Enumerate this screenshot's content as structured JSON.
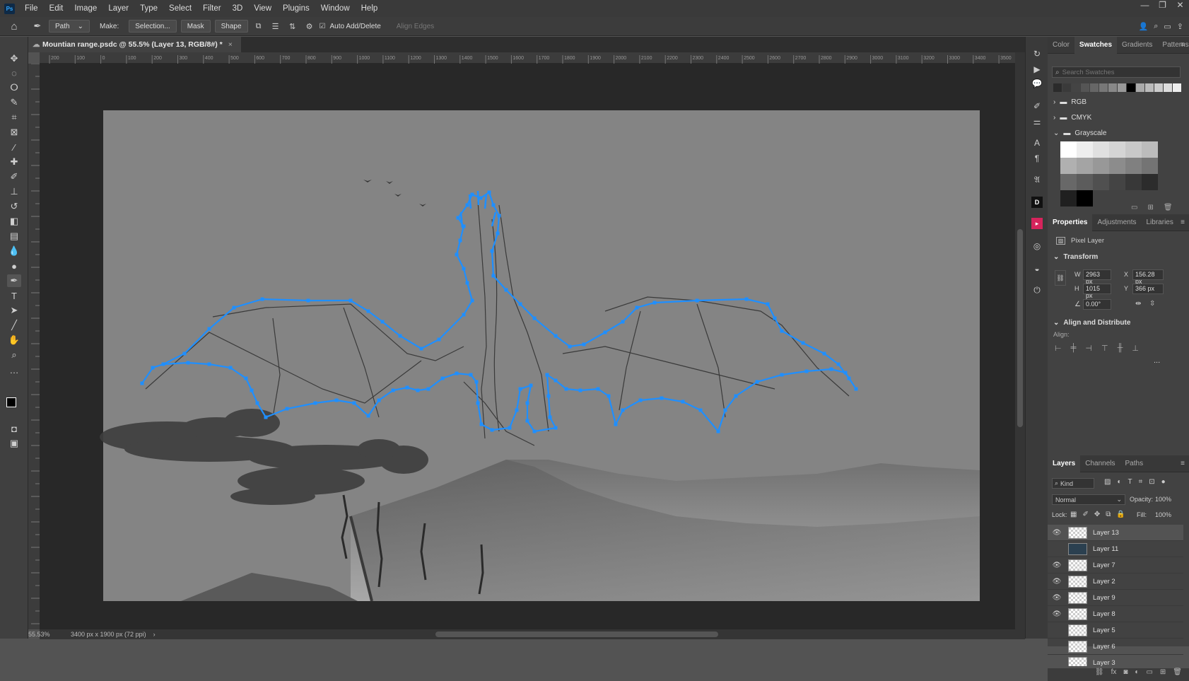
{
  "app": {
    "logo": "Ps"
  },
  "menu": [
    "File",
    "Edit",
    "Image",
    "Layer",
    "Type",
    "Select",
    "Filter",
    "3D",
    "View",
    "Plugins",
    "Window",
    "Help"
  ],
  "window_controls": [
    "—",
    "❐",
    "✕"
  ],
  "options_bar": {
    "tool_mode": "Path",
    "make_label": "Make:",
    "selection_btn": "Selection...",
    "mask_btn": "Mask",
    "shape_btn": "Shape",
    "auto_add_delete": "Auto Add/Delete",
    "align_edges": "Align Edges"
  },
  "document": {
    "tab_title": "Mountian range.psdc @ 55.5% (Layer 13, RGB/8#) *",
    "close": "×"
  },
  "ruler_labels": [
    "200",
    "100",
    "0",
    "100",
    "200",
    "300",
    "400",
    "500",
    "600",
    "700",
    "800",
    "900",
    "1000",
    "1100",
    "1200",
    "1300",
    "1400",
    "1500",
    "1600",
    "1700",
    "1800",
    "1900",
    "2000",
    "2100",
    "2200",
    "2300",
    "2400",
    "2500",
    "2600",
    "2700",
    "2800",
    "2900",
    "3000",
    "3100",
    "3200",
    "3300",
    "3400",
    "3500"
  ],
  "status": {
    "zoom": "55.53%",
    "doc_info": "3400 px x 1900 px (72 ppi)"
  },
  "swatches_panel": {
    "tabs": [
      "Color",
      "Swatches",
      "Gradients",
      "Patterns"
    ],
    "active_tab": "Swatches",
    "search_placeholder": "Search Swatches",
    "groups": [
      "RGB",
      "CMYK",
      "Grayscale"
    ],
    "recent_colors": [
      "#2b2b2b",
      "#3a3a3a",
      "#444444",
      "#555555",
      "#666666",
      "#777777",
      "#888888",
      "#999999",
      "#000000",
      "#aaaaaa",
      "#bbbbbb",
      "#cccccc",
      "#dddddd",
      "#eeeeee"
    ],
    "grayscale_colors": [
      "#ffffff",
      "#eeeeee",
      "#e0e0e0",
      "#d4d4d4",
      "#c8c8c8",
      "#bcbcbc",
      "#b0b0b0",
      "#a4a4a4",
      "#989898",
      "#8c8c8c",
      "#808080",
      "#747474",
      "#686868",
      "#5c5c5c",
      "#505050",
      "#444444",
      "#383838",
      "#2c2c2c",
      "#202020",
      "#000000"
    ]
  },
  "properties_panel": {
    "tabs": [
      "Properties",
      "Adjustments",
      "Libraries"
    ],
    "active_tab": "Properties",
    "layer_type": "Pixel Layer",
    "transform_label": "Transform",
    "w_label": "W",
    "w": "2963 px",
    "x_label": "X",
    "x": "156.28 px",
    "h_label": "H",
    "h": "1015 px",
    "y_label": "Y",
    "y": "366 px",
    "angle": "0.00°",
    "align_label": "Align and Distribute",
    "align_sub": "Align:",
    "more": "..."
  },
  "layers_panel": {
    "tabs": [
      "Layers",
      "Channels",
      "Paths"
    ],
    "active_tab": "Layers",
    "kind": "Kind",
    "blend_mode": "Normal",
    "opacity_label": "Opacity:",
    "opacity": "100%",
    "lock_label": "Lock:",
    "fill_label": "Fill:",
    "fill": "100%",
    "layers": [
      {
        "name": "Layer 13",
        "visible": true,
        "selected": true
      },
      {
        "name": "Layer 11",
        "visible": false,
        "selected": false
      },
      {
        "name": "Layer 7",
        "visible": true,
        "selected": false
      },
      {
        "name": "Layer 2",
        "visible": true,
        "selected": false
      },
      {
        "name": "Layer 9",
        "visible": true,
        "selected": false
      },
      {
        "name": "Layer 8",
        "visible": true,
        "selected": false
      },
      {
        "name": "Layer 5",
        "visible": false,
        "selected": false
      },
      {
        "name": "Layer 6",
        "visible": false,
        "selected": false
      },
      {
        "name": "Layer 3",
        "visible": false,
        "selected": false
      }
    ]
  },
  "colors": {
    "path_blue": "#1f8fff",
    "accent": "#31a8ff"
  }
}
